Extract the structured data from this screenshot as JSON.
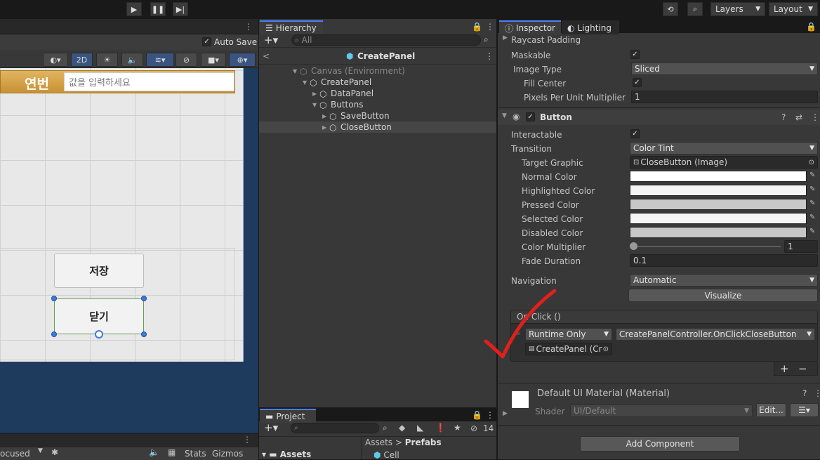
{
  "toolbar": {
    "play_icon": "play-icon",
    "pause_icon": "pause-icon",
    "step_icon": "step-icon",
    "layers_label": "Layers",
    "layout_label": "Layout"
  },
  "scene": {
    "auto_save_label": "Auto Save",
    "mode_2d": "2D",
    "row_label": "연번",
    "input_placeholder": "값을 입력하세요",
    "save_button": "저장",
    "close_button": "닫기",
    "bottom_focus": "ocused",
    "stats_label": "Stats",
    "gizmos_label": "Gizmos"
  },
  "hierarchy": {
    "tab_label": "Hierarchy",
    "search_placeholder": "All",
    "scene_title": "CreatePanel",
    "items": [
      {
        "label": "Canvas (Environment)"
      },
      {
        "label": "CreatePanel"
      },
      {
        "label": "DataPanel"
      },
      {
        "label": "Buttons"
      },
      {
        "label": "SaveButton"
      },
      {
        "label": "CloseButton"
      }
    ]
  },
  "project": {
    "tab_label": "Project",
    "count": "14",
    "assets_label": "Assets",
    "breadcrumb": [
      "Assets",
      "Prefabs"
    ],
    "cell_label": "Cell"
  },
  "inspector": {
    "tab_label": "Inspector",
    "lighting_tab": "Lighting",
    "raycast_padding": "Raycast Padding",
    "maskable": "Maskable",
    "image_type_label": "Image Type",
    "image_type_value": "Sliced",
    "fill_center": "Fill Center",
    "ppu_label": "Pixels Per Unit Multiplier",
    "ppu_value": "1",
    "button_component": "Button",
    "interactable": "Interactable",
    "transition_label": "Transition",
    "transition_value": "Color Tint",
    "target_graphic_label": "Target Graphic",
    "target_graphic_value": "CloseButton (Image)",
    "normal_color": "Normal Color",
    "highlighted_color": "Highlighted Color",
    "pressed_color": "Pressed Color",
    "selected_color": "Selected Color",
    "disabled_color": "Disabled Color",
    "color_multiplier_label": "Color Multiplier",
    "color_multiplier_value": "1",
    "fade_duration_label": "Fade Duration",
    "fade_duration_value": "0.1",
    "navigation_label": "Navigation",
    "navigation_value": "Automatic",
    "visualize_button": "Visualize",
    "onclick_header": "On Click ()",
    "runtime_value": "Runtime Only",
    "function_value": "CreatePanelController.OnClickCloseButton",
    "object_value": "CreatePanel (Cr",
    "material_title": "Default UI Material (Material)",
    "shader_label": "Shader",
    "shader_value": "UI/Default",
    "edit_button": "Edit...",
    "add_component_button": "Add Component"
  },
  "colors": {
    "accent": "#4c7fff",
    "annotation_check": "#e0201c",
    "normal": "#ffffff",
    "highlighted": "#f5f5f5",
    "pressed": "#c8c8c8",
    "selected": "#f5f5f5",
    "disabled": "#c8c8c8"
  }
}
